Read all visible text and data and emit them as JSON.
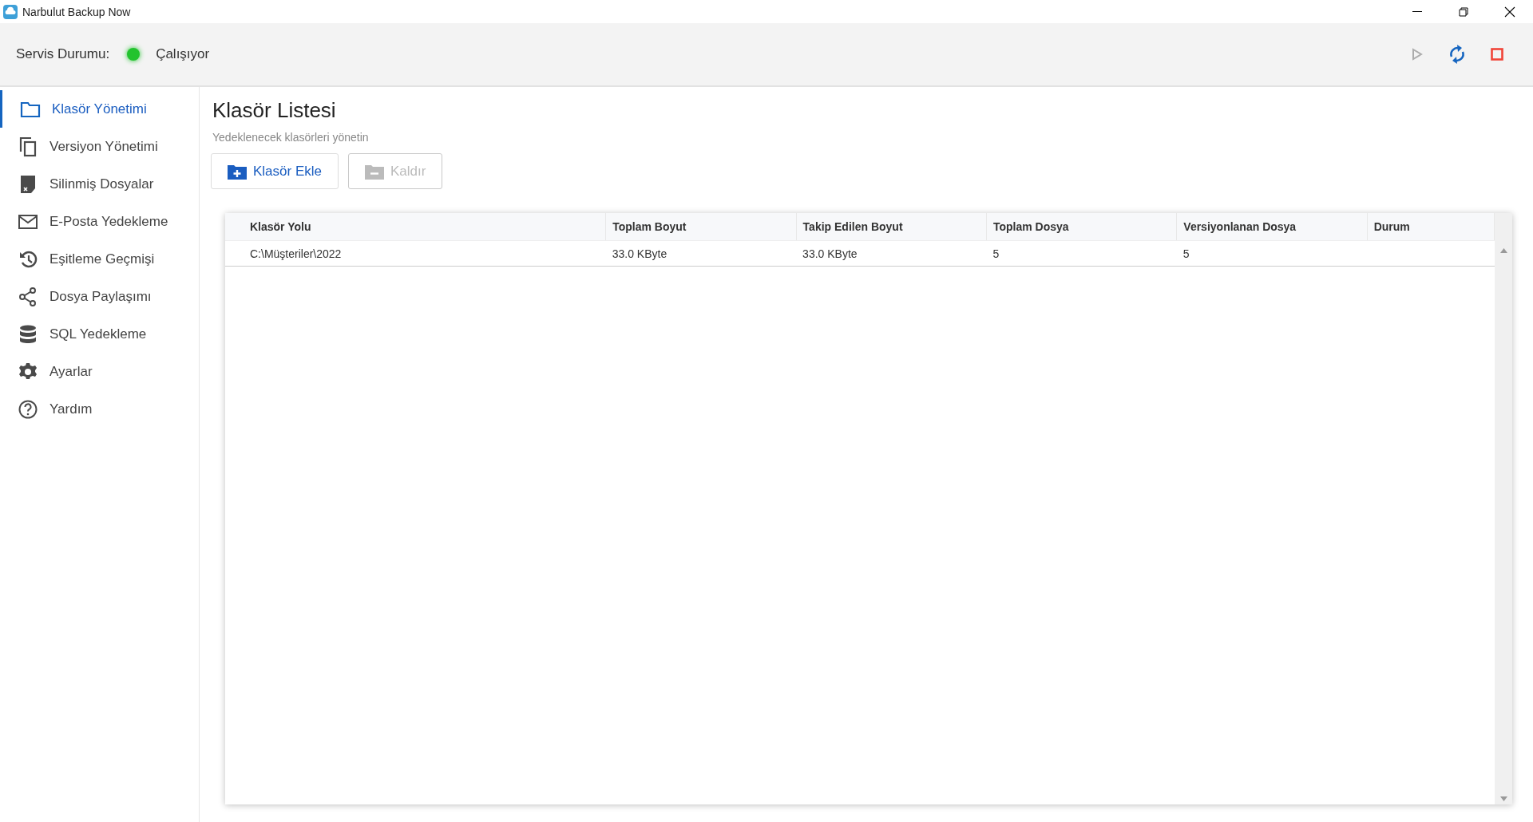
{
  "window": {
    "title": "Narbulut Backup Now"
  },
  "service_status": {
    "label": "Servis Durumu:",
    "color": "#22c32e",
    "value": "Çalışıyor"
  },
  "toolbar": [
    {
      "kind": "play",
      "disabled": true
    },
    {
      "kind": "refresh",
      "disabled": false
    },
    {
      "kind": "stop",
      "disabled": false
    }
  ],
  "sidebar": {
    "items": [
      {
        "kind": "folder",
        "label": "Klasör Yönetimi",
        "selected": true
      },
      {
        "kind": "copies",
        "label": "Versiyon Yönetimi",
        "selected": false
      },
      {
        "kind": "deleted",
        "label": "Silinmiş Dosyalar",
        "selected": false
      },
      {
        "kind": "mail",
        "label": "E-Posta Yedekleme",
        "selected": false
      },
      {
        "kind": "history",
        "label": "Eşitleme Geçmişi",
        "selected": false
      },
      {
        "kind": "share",
        "label": "Dosya Paylaşımı",
        "selected": false
      },
      {
        "kind": "database",
        "label": "SQL Yedekleme",
        "selected": false
      },
      {
        "kind": "gear",
        "label": "Ayarlar",
        "selected": false
      },
      {
        "kind": "help",
        "label": "Yardım",
        "selected": false
      }
    ]
  },
  "page": {
    "title": "Klasör Listesi",
    "subtitle": "Yedeklenecek klasörleri yönetin",
    "buttons": [
      {
        "kind": "add",
        "label": "Klasör Ekle",
        "disabled": false
      },
      {
        "kind": "remove",
        "label": "Kaldır",
        "disabled": true
      }
    ]
  },
  "table": {
    "columns": [
      "Klasör Yolu",
      "Toplam Boyut",
      "Takip Edilen Boyut",
      "Toplam Dosya",
      "Versiyonlanan Dosya",
      "Durum"
    ],
    "rows": [
      [
        "C:\\Müşteriler\\2022",
        "33.0 KByte",
        "33.0 KByte",
        "5",
        "5",
        ""
      ]
    ]
  }
}
